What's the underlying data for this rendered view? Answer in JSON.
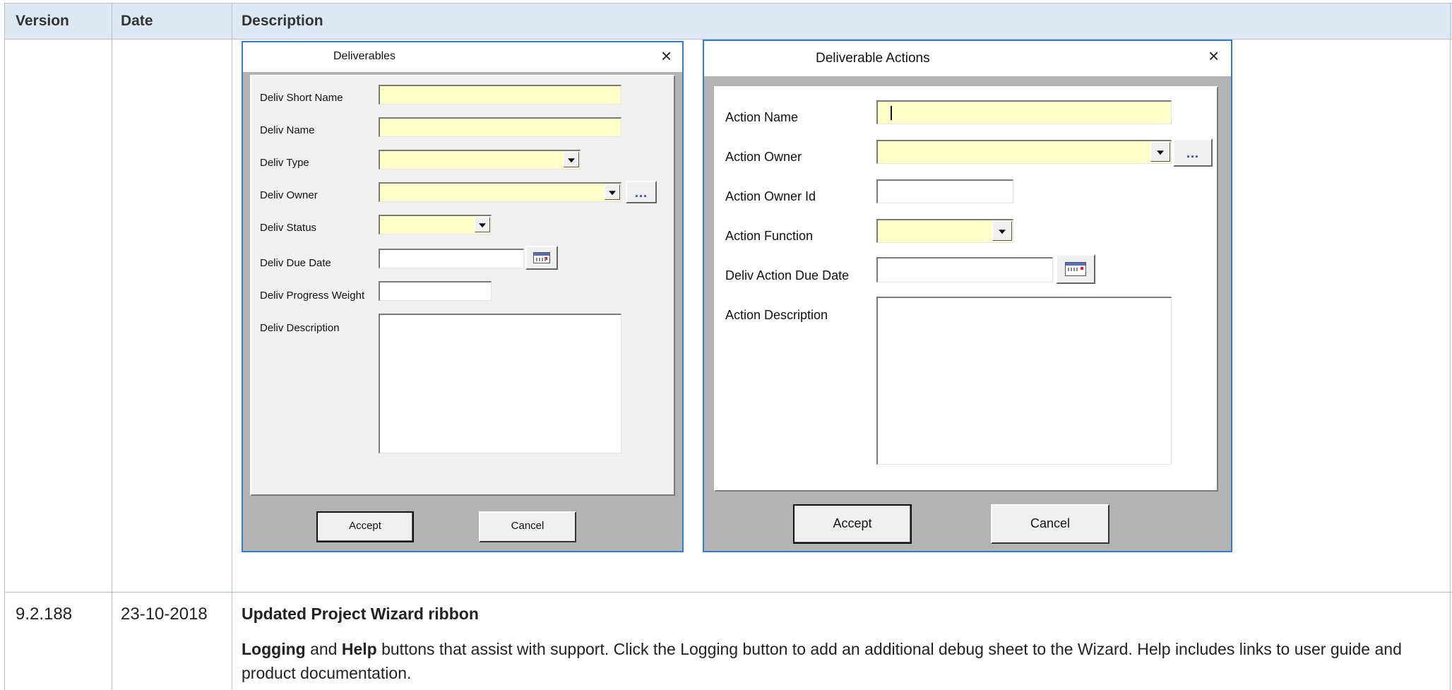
{
  "table": {
    "headers": {
      "version": "Version",
      "date": "Date",
      "description": "Description"
    },
    "row": {
      "version": "9.2.188",
      "date": "23-10-2018",
      "title": "Updated Project Wizard ribbon",
      "body_part1_bold": "Logging",
      "body_part2": " and ",
      "body_part3_bold": "Help",
      "body_part4": " buttons that assist with support. Click the Logging button to add an additional debug sheet to the Wizard.  Help includes links to user guide and product documentation."
    }
  },
  "deliverables_dialog": {
    "title": "Deliverables",
    "close": "×",
    "labels": {
      "short_name": "Deliv Short Name",
      "name": "Deliv Name",
      "type": "Deliv Type",
      "owner": "Deliv Owner",
      "status": "Deliv Status",
      "due_date": "Deliv Due Date",
      "progress_weight": "Deliv Progress Weight",
      "description": "Deliv Description"
    },
    "ellipsis": "...",
    "accept": "Accept",
    "cancel": "Cancel"
  },
  "actions_dialog": {
    "title": "Deliverable Actions",
    "close": "×",
    "labels": {
      "action_name": "Action Name",
      "action_owner": "Action Owner",
      "action_owner_id": "Action Owner Id",
      "action_function": "Action Function",
      "due_date": "Deliv Action Due Date",
      "description": "Action Description"
    },
    "ellipsis": "...",
    "accept": "Accept",
    "cancel": "Cancel"
  },
  "colors": {
    "header_bg": "#dde8f3",
    "field_yellow": "#ffffc8",
    "dialog_border": "#2d7fd3",
    "dialog_body": "#b3b3b3"
  }
}
